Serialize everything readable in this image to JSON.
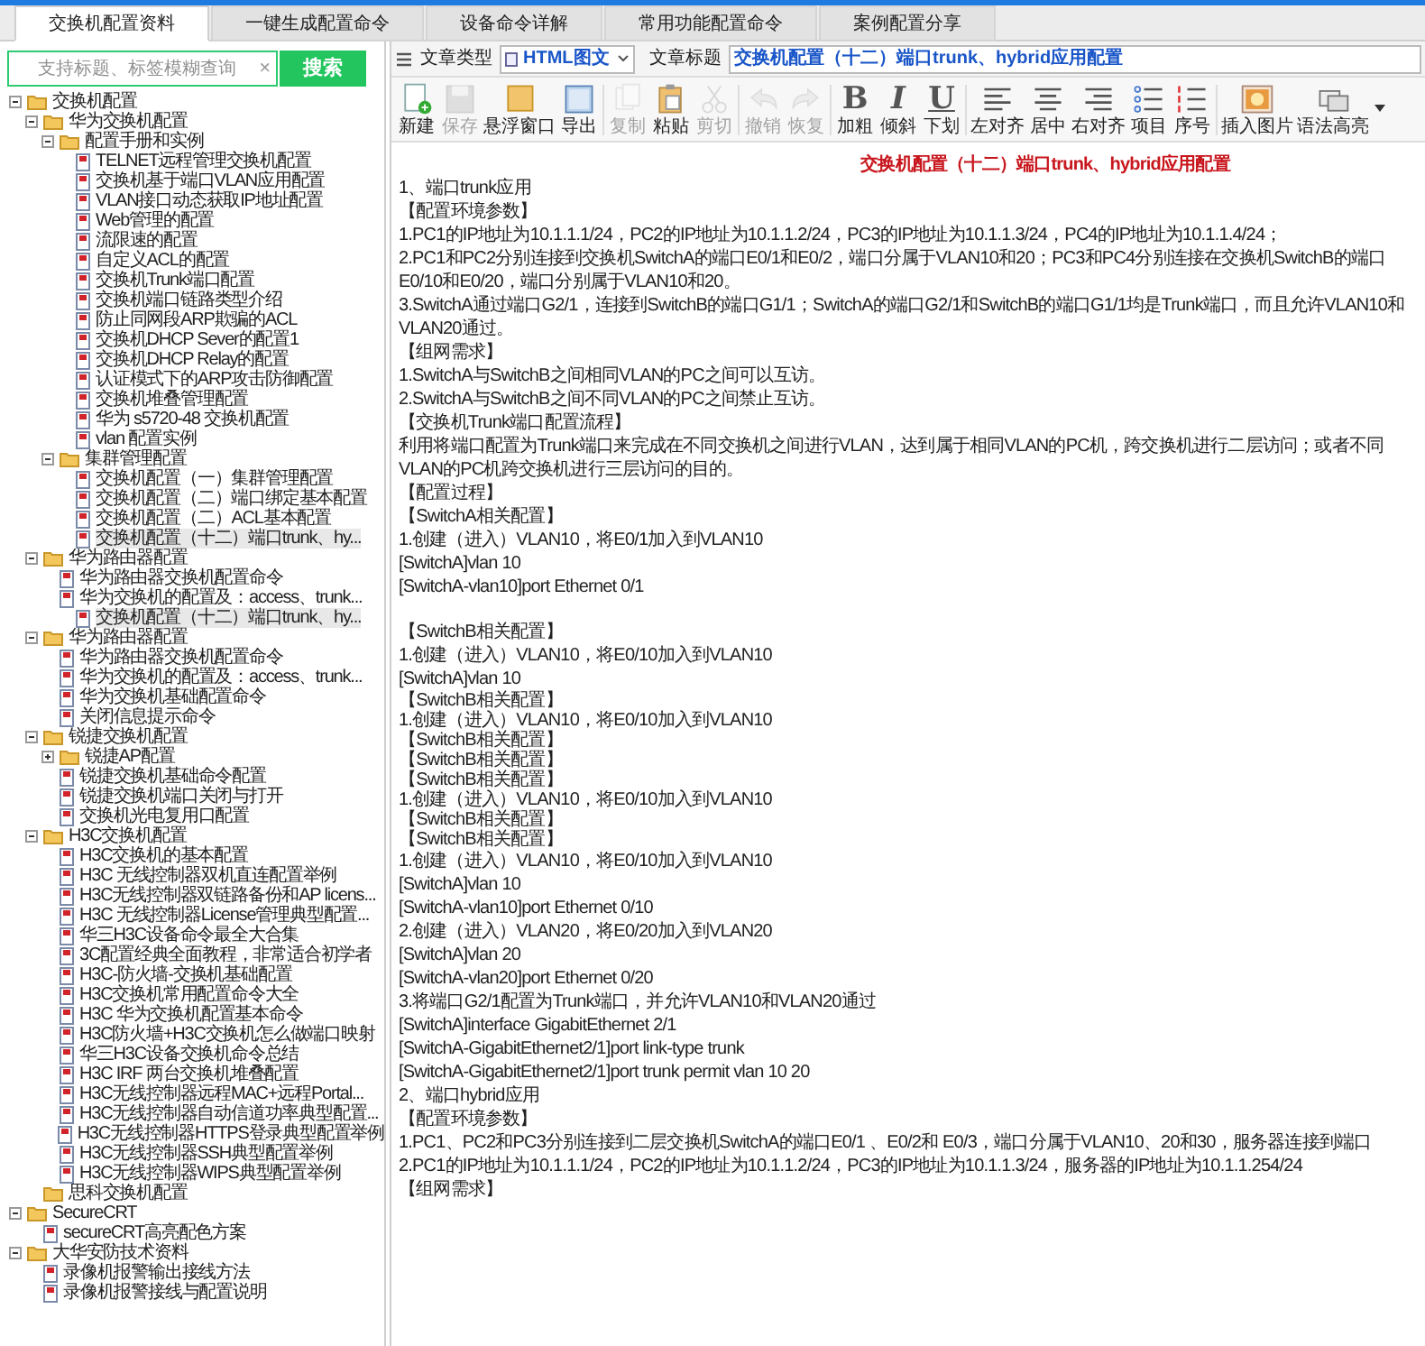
{
  "tabs": [
    {
      "label": "交换机配置资料",
      "selected": true
    },
    {
      "label": "一键生成配置命令",
      "selected": false
    },
    {
      "label": "设备命令详解",
      "selected": false
    },
    {
      "label": "常用功能配置命令",
      "selected": false
    },
    {
      "label": "案例配置分享",
      "selected": false
    }
  ],
  "search": {
    "placeholder": "支持标题、标签模糊查询",
    "clear": "×",
    "button": "搜索"
  },
  "tree": [
    {
      "label": "交换机配置",
      "kind": "folder",
      "expanded": true,
      "selected": false,
      "children": [
        {
          "label": "华为交换机配置",
          "kind": "folder",
          "expanded": true,
          "selected": false,
          "children": [
            {
              "label": "配置手册和实例",
              "kind": "folder",
              "expanded": true,
              "selected": false,
              "children": [
                {
                  "label": "TELNET远程管理交换机配置",
                  "kind": "doc",
                  "selected": false
                },
                {
                  "label": "交换机基于端口VLAN应用配置",
                  "kind": "doc",
                  "selected": false
                },
                {
                  "label": "VLAN接口动态获取IP地址配置",
                  "kind": "doc",
                  "selected": false
                },
                {
                  "label": "Web管理的配置",
                  "kind": "doc",
                  "selected": false
                },
                {
                  "label": "流限速的配置",
                  "kind": "doc",
                  "selected": false
                },
                {
                  "label": "自定义ACL的配置",
                  "kind": "doc",
                  "selected": false
                },
                {
                  "label": "交换机Trunk端口配置",
                  "kind": "doc",
                  "selected": false
                },
                {
                  "label": "交换机端口链路类型介绍",
                  "kind": "doc",
                  "selected": false
                },
                {
                  "label": "防止同网段ARP欺骗的ACL",
                  "kind": "doc",
                  "selected": false
                },
                {
                  "label": "交换机DHCP Sever的配置1",
                  "kind": "doc",
                  "selected": false
                },
                {
                  "label": "交换机DHCP Relay的配置",
                  "kind": "doc",
                  "selected": false
                },
                {
                  "label": "认证模式下的ARP攻击防御配置",
                  "kind": "doc",
                  "selected": false
                },
                {
                  "label": "交换机堆叠管理配置",
                  "kind": "doc",
                  "selected": false
                },
                {
                  "label": "华为  s5720-48  交换机配置",
                  "kind": "doc",
                  "selected": false
                },
                {
                  "label": "vlan 配置实例",
                  "kind": "doc",
                  "selected": false
                }
              ]
            },
            {
              "label": "集群管理配置",
              "kind": "folder",
              "expanded": true,
              "selected": false,
              "children": [
                {
                  "label": "交换机配置（一）集群管理配置",
                  "kind": "doc",
                  "selected": false
                },
                {
                  "label": "交换机配置（二）端口绑定基本配置",
                  "kind": "doc",
                  "selected": false
                },
                {
                  "label": "交换机配置（二）ACL基本配置",
                  "kind": "doc",
                  "selected": false
                },
                {
                  "label": "交换机配置（十二）端口trunk、hy...",
                  "kind": "doc",
                  "selected": true
                }
              ]
            }
          ]
        },
        {
          "label": "华为路由器配置",
          "kind": "folder",
          "expanded": true,
          "selected": false,
          "children": [
            {
              "label": "华为路由器交换机配置命令",
              "kind": "doc",
              "selected": false
            },
            {
              "label": "华为交换机的配置及：access、trunk...",
              "kind": "doc",
              "selected": false,
              "children": [
                {
                  "label": "交换机配置（十二）端口trunk、hy...",
                  "kind": "doc",
                  "selected": true
                }
              ]
            }
          ]
        },
        {
          "label": "华为路由器配置",
          "kind": "folder",
          "expanded": true,
          "selected": false,
          "children": [
            {
              "label": "华为路由器交换机配置命令",
              "kind": "doc",
              "selected": false
            },
            {
              "label": "华为交换机的配置及：access、trunk...",
              "kind": "doc",
              "selected": false
            },
            {
              "label": "华为交换机基础配置命令",
              "kind": "doc",
              "selected": false
            },
            {
              "label": "关闭信息提示命令",
              "kind": "doc",
              "selected": false
            }
          ]
        },
        {
          "label": "锐捷交换机配置",
          "kind": "folder",
          "expanded": true,
          "selected": false,
          "children": [
            {
              "label": "锐捷AP配置",
              "kind": "folder",
              "expanded": false,
              "selected": false
            },
            {
              "label": "锐捷交换机基础命令配置",
              "kind": "doc",
              "selected": false
            },
            {
              "label": "锐捷交换机端口关闭与打开",
              "kind": "doc",
              "selected": false
            },
            {
              "label": "交换机光电复用口配置",
              "kind": "doc",
              "selected": false
            }
          ]
        },
        {
          "label": "H3C交换机配置",
          "kind": "folder",
          "expanded": true,
          "selected": false,
          "children": [
            {
              "label": "H3C交换机的基本配置",
              "kind": "doc",
              "selected": false
            },
            {
              "label": "H3C 无线控制器双机直连配置举例",
              "kind": "doc",
              "selected": false
            },
            {
              "label": "H3C无线控制器双链路备份和AP licens...",
              "kind": "doc",
              "selected": false
            },
            {
              "label": "H3C 无线控制器License管理典型配置...",
              "kind": "doc",
              "selected": false
            },
            {
              "label": "华三H3C设备命令最全大合集",
              "kind": "doc",
              "selected": false
            },
            {
              "label": "3C配置经典全面教程，非常适合初学者",
              "kind": "doc",
              "selected": false
            },
            {
              "label": "H3C-防火墙-交换机基础配置",
              "kind": "doc",
              "selected": false
            },
            {
              "label": "H3C交换机常用配置命令大全",
              "kind": "doc",
              "selected": false
            },
            {
              "label": "H3C 华为交换机配置基本命令",
              "kind": "doc",
              "selected": false
            },
            {
              "label": "H3C防火墙+H3C交换机怎么做端口映射",
              "kind": "doc",
              "selected": false
            },
            {
              "label": "华三H3C设备交换机命令总结",
              "kind": "doc",
              "selected": false
            },
            {
              "label": "H3C IRF 两台交换机堆叠配置",
              "kind": "doc",
              "selected": false
            },
            {
              "label": "H3C无线控制器远程MAC+远程Portal...",
              "kind": "doc",
              "selected": false
            },
            {
              "label": "H3C无线控制器自动信道功率典型配置...",
              "kind": "doc",
              "selected": false
            },
            {
              "label": "H3C无线控制器HTTPS登录典型配置举例",
              "kind": "doc",
              "selected": false
            },
            {
              "label": "H3C无线控制器SSH典型配置举例",
              "kind": "doc",
              "selected": false
            },
            {
              "label": "H3C无线控制器WIPS典型配置举例",
              "kind": "doc",
              "selected": false
            }
          ]
        },
        {
          "label": "思科交换机配置",
          "kind": "folder",
          "selected": false
        }
      ]
    },
    {
      "label": "SecureCRT",
      "kind": "folder",
      "expanded": true,
      "selected": false,
      "children": [
        {
          "label": "secureCRT高亮配色方案",
          "kind": "doc",
          "selected": false
        }
      ]
    },
    {
      "label": "大华安防技术资料",
      "kind": "folder",
      "expanded": true,
      "selected": false,
      "children": [
        {
          "label": "录像机报警输出接线方法",
          "kind": "doc",
          "selected": false
        },
        {
          "label": "录像机报警接线与配置说明",
          "kind": "doc",
          "selected": false
        }
      ]
    }
  ],
  "editor": {
    "type_label": "文章类型",
    "type_value": "HTML图文",
    "title_label": "文章标题",
    "title_value": "交换机配置（十二）端口trunk、hybrid应用配置"
  },
  "toolbar": [
    {
      "label": "新建",
      "disabled": false
    },
    {
      "label": "保存",
      "disabled": true
    },
    {
      "label": "悬浮窗口",
      "disabled": false
    },
    {
      "label": "导出",
      "disabled": false
    },
    {
      "label": "复制",
      "disabled": true
    },
    {
      "label": "粘贴",
      "disabled": false
    },
    {
      "label": "剪切",
      "disabled": true
    },
    {
      "label": "撤销",
      "disabled": true
    },
    {
      "label": "恢复",
      "disabled": true
    },
    {
      "label": "加粗",
      "glyph": "B",
      "disabled": false
    },
    {
      "label": "倾斜",
      "glyph": "I",
      "disabled": false
    },
    {
      "label": "下划",
      "glyph": "U",
      "disabled": false
    },
    {
      "label": "左对齐",
      "disabled": false
    },
    {
      "label": "居中",
      "disabled": false
    },
    {
      "label": "右对齐",
      "disabled": false
    },
    {
      "label": "项目",
      "disabled": false
    },
    {
      "label": "序号",
      "disabled": false
    },
    {
      "label": "插入图片",
      "disabled": false
    },
    {
      "label": "语法高亮",
      "disabled": false
    }
  ],
  "content": [
    {
      "kind": "title",
      "text": "交换机配置（十二）端口trunk、hybrid应用配置"
    },
    {
      "kind": "para",
      "text": "1、端口trunk应用"
    },
    {
      "kind": "para",
      "text": "【配置环境参数】"
    },
    {
      "kind": "para",
      "text": "1.PC1的IP地址为10.1.1.1/24，PC2的IP地址为10.1.1.2/24，PC3的IP地址为10.1.1.3/24，PC4的IP地址为10.1.1.4/24；"
    },
    {
      "kind": "para",
      "text": "2.PC1和PC2分别连接到交换机SwitchA的端口E0/1和E0/2，端口分属于VLAN10和20；PC3和PC4分别连接在交换机SwitchB的端口E0/10和E0/20，端口分别属于VLAN10和20。"
    },
    {
      "kind": "para",
      "text": "3.SwitchA通过端口G2/1，连接到SwitchB的端口G1/1；SwitchA的端口G2/1和SwitchB的端口G1/1均是Trunk端口，而且允许VLAN10和VLAN20通过。"
    },
    {
      "kind": "para",
      "text": "【组网需求】"
    },
    {
      "kind": "para",
      "text": "1.SwitchA与SwitchB之间相同VLAN的PC之间可以互访。"
    },
    {
      "kind": "para",
      "text": "2.SwitchA与SwitchB之间不同VLAN的PC之间禁止互访。"
    },
    {
      "kind": "para",
      "text": "【交换机Trunk端口配置流程】"
    },
    {
      "kind": "para",
      "text": "利用将端口配置为Trunk端口来完成在不同交换机之间进行VLAN，达到属于相同VLAN的PC机，跨交换机进行二层访问；或者不同VLAN的PC机跨交换机进行三层访问的目的。"
    },
    {
      "kind": "para",
      "text": "【配置过程】"
    },
    {
      "kind": "para",
      "text": "【SwitchA相关配置】"
    },
    {
      "kind": "para",
      "text": "1.创建（进入）VLAN10，将E0/1加入到VLAN10"
    },
    {
      "kind": "para",
      "text": "[SwitchA]vlan 10"
    },
    {
      "kind": "para",
      "text": "[SwitchA-vlan10]port Ethernet 0/1"
    },
    {
      "kind": "gap",
      "text": "【SwitchB相关配置】"
    },
    {
      "kind": "para",
      "text": "1.创建（进入）VLAN10，将E0/10加入到VLAN10"
    },
    {
      "kind": "para",
      "text": "[SwitchA]vlan 10"
    },
    {
      "kind": "tight",
      "text": "【SwitchB相关配置】"
    },
    {
      "kind": "tight",
      "text": "1.创建（进入）VLAN10，将E0/10加入到VLAN10"
    },
    {
      "kind": "tight",
      "text": "【SwitchB相关配置】"
    },
    {
      "kind": "tight",
      "text": "【SwitchB相关配置】"
    },
    {
      "kind": "tight",
      "text": "【SwitchB相关配置】"
    },
    {
      "kind": "tight",
      "text": "1.创建（进入）VLAN10，将E0/10加入到VLAN10"
    },
    {
      "kind": "tight",
      "text": "【SwitchB相关配置】"
    },
    {
      "kind": "tight",
      "text": "【SwitchB相关配置】"
    },
    {
      "kind": "para",
      "text": "1.创建（进入）VLAN10，将E0/10加入到VLAN10"
    },
    {
      "kind": "para",
      "text": "[SwitchA]vlan 10"
    },
    {
      "kind": "para",
      "text": "[SwitchA-vlan10]port Ethernet 0/10"
    },
    {
      "kind": "para",
      "text": "2.创建（进入）VLAN20，将E0/20加入到VLAN20"
    },
    {
      "kind": "para",
      "text": "[SwitchA]vlan 20"
    },
    {
      "kind": "para",
      "text": "[SwitchA-vlan20]port Ethernet 0/20"
    },
    {
      "kind": "para",
      "text": "3.将端口G2/1配置为Trunk端口，并允许VLAN10和VLAN20通过"
    },
    {
      "kind": "para",
      "text": "[SwitchA]interface GigabitEthernet 2/1"
    },
    {
      "kind": "para",
      "text": "[SwitchA-GigabitEthernet2/1]port link-type trunk"
    },
    {
      "kind": "para",
      "text": "[SwitchA-GigabitEthernet2/1]port trunk permit vlan 10 20"
    },
    {
      "kind": "para",
      "text": "2、端口hybrid应用"
    },
    {
      "kind": "para",
      "text": "【配置环境参数】"
    },
    {
      "kind": "para",
      "text": "1.PC1、PC2和PC3分别连接到二层交换机SwitchA的端口E0/1 、E0/2和 E0/3，端口分属于VLAN10、20和30，服务器连接到端口"
    },
    {
      "kind": "para",
      "text": "2.PC1的IP地址为10.1.1.1/24，PC2的IP地址为10.1.1.2/24，PC3的IP地址为10.1.1.3/24，服务器的IP地址为10.1.1.254/24"
    },
    {
      "kind": "para",
      "text": "【组网需求】"
    }
  ]
}
